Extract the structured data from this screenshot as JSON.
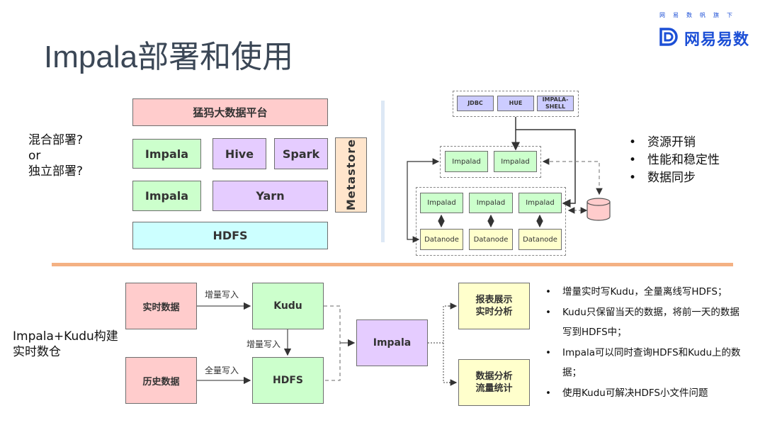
{
  "page_title": "Impala部署和使用",
  "brand": {
    "tagline": "网易数帆旗下",
    "name": "网易易数",
    "color": "#1c4fd6"
  },
  "deployment": {
    "question_lines": [
      "混合部署?",
      "or",
      "独立部署?"
    ],
    "stack": {
      "platform": "猛犸大数据平台",
      "row1": [
        "Impala",
        "Hive",
        "Spark"
      ],
      "row2": [
        "Impala",
        "Yarn"
      ],
      "storage": "HDFS",
      "metastore": "Metastore"
    },
    "architecture": {
      "clients": [
        "JDBC",
        "HUE",
        "IMPALA-SHELL"
      ],
      "coordinators": [
        "Impalad",
        "Impalad"
      ],
      "workers": [
        {
          "impalad": "Impalad",
          "datanode": "Datanode"
        },
        {
          "impalad": "Impalad",
          "datanode": "Datanode"
        },
        {
          "impalad": "Impalad",
          "datanode": "Datanode"
        }
      ],
      "database_icon": "database-icon"
    },
    "concerns": [
      "资源开销",
      "性能和稳定性",
      "数据同步"
    ]
  },
  "realtime": {
    "label_lines": [
      "Impala+Kudu构建",
      "实时数仓"
    ],
    "sources": [
      "实时数据",
      "历史数据"
    ],
    "stores": [
      "Kudu",
      "HDFS"
    ],
    "edge_labels": {
      "realtime_to_kudu": "增量写入",
      "kudu_to_hdfs": "增量写入",
      "history_to_hdfs": "全量写入"
    },
    "engine": "Impala",
    "outputs": [
      [
        "报表展示",
        "实时分析"
      ],
      [
        "数据分析",
        "流量统计"
      ]
    ],
    "notes": [
      "增量实时写Kudu，全量离线写HDFS；",
      "Kudu只保留当天的数据，将前一天的数据写到HDFS中；",
      "Impala可以同时查询HDFS和Kudu上的数据；",
      "使用Kudu可解决HDFS小文件问题"
    ]
  },
  "colors": {
    "divider": "#f4b183",
    "vertical_divider": "#dde8f5",
    "title": "#3b4756"
  }
}
